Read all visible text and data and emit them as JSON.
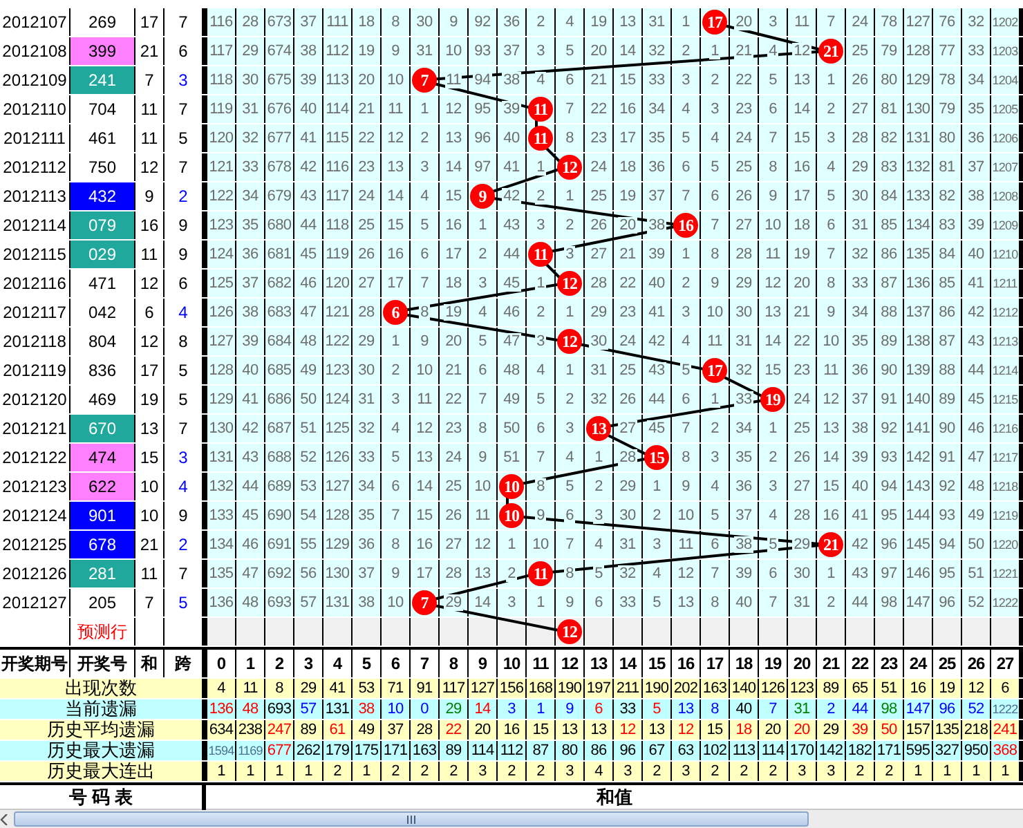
{
  "rows": [
    {
      "period": "2012107",
      "number": "269",
      "sum": "17",
      "span": "7",
      "cells": [
        "116",
        "28",
        "673",
        "37",
        "111",
        "18",
        "8",
        "30",
        "9",
        "92",
        "36",
        "2",
        "4",
        "19",
        "13",
        "31",
        "1",
        {
          "value": "17",
          "hit": true
        },
        "20",
        "3",
        "11",
        "7",
        "24",
        "78",
        "127",
        "76",
        "32",
        "1202"
      ]
    },
    {
      "period": "2012108",
      "number": {
        "value": "399",
        "color": "#ff80ff"
      },
      "sum": "21",
      "span": "6",
      "cells": [
        "117",
        "29",
        "674",
        "38",
        "112",
        "19",
        "9",
        "31",
        "10",
        "93",
        "37",
        "3",
        "5",
        "20",
        "14",
        "32",
        "2",
        "1",
        "21",
        "4",
        "12",
        {
          "value": "21",
          "hit": true
        },
        "25",
        "79",
        "128",
        "77",
        "33",
        "1203"
      ]
    },
    {
      "period": "2012109",
      "number": {
        "value": "241",
        "color": "#20a89c"
      },
      "sum": "7",
      "span": {
        "value": "3",
        "color": "#0000ff"
      },
      "cells": [
        "118",
        "30",
        "675",
        "39",
        "113",
        "20",
        "10",
        {
          "value": "7",
          "hit": true
        },
        "11",
        "94",
        "38",
        "4",
        "6",
        "21",
        "15",
        "33",
        "3",
        "2",
        "22",
        "5",
        "13",
        "1",
        "26",
        "80",
        "129",
        "78",
        "34",
        "1204"
      ]
    },
    {
      "period": "2012110",
      "number": "704",
      "sum": "11",
      "span": "7",
      "cells": [
        "119",
        "31",
        "676",
        "40",
        "114",
        "21",
        "11",
        "1",
        "12",
        "95",
        "39",
        {
          "value": "11",
          "hit": true
        },
        "7",
        "22",
        "16",
        "34",
        "4",
        "3",
        "23",
        "6",
        "14",
        "2",
        "27",
        "81",
        "130",
        "79",
        "35",
        "1205"
      ]
    },
    {
      "period": "2012111",
      "number": "461",
      "sum": "11",
      "span": "5",
      "cells": [
        "120",
        "32",
        "677",
        "41",
        "115",
        "22",
        "12",
        "2",
        "13",
        "96",
        "40",
        {
          "value": "11",
          "hit": true
        },
        "8",
        "23",
        "17",
        "35",
        "5",
        "4",
        "24",
        "7",
        "15",
        "3",
        "28",
        "82",
        "131",
        "80",
        "36",
        "1206"
      ]
    },
    {
      "period": "2012112",
      "number": "750",
      "sum": "12",
      "span": "7",
      "cells": [
        "121",
        "33",
        "678",
        "42",
        "116",
        "23",
        "13",
        "3",
        "14",
        "97",
        "41",
        "1",
        {
          "value": "12",
          "hit": true
        },
        "24",
        "18",
        "36",
        "6",
        "5",
        "25",
        "8",
        "16",
        "4",
        "29",
        "83",
        "132",
        "81",
        "37",
        "1207"
      ]
    },
    {
      "period": "2012113",
      "number": {
        "value": "432",
        "color": "#0000ff"
      },
      "sum": "9",
      "span": {
        "value": "2",
        "color": "#0000ff"
      },
      "cells": [
        "122",
        "34",
        "679",
        "43",
        "117",
        "24",
        "14",
        "4",
        "15",
        {
          "value": "9",
          "hit": true
        },
        "42",
        "2",
        "1",
        "25",
        "19",
        "37",
        "7",
        "6",
        "26",
        "9",
        "17",
        "5",
        "30",
        "84",
        "133",
        "82",
        "38",
        "1208"
      ]
    },
    {
      "period": "2012114",
      "number": {
        "value": "079",
        "color": "#20a89c"
      },
      "sum": "16",
      "span": "9",
      "cells": [
        "123",
        "35",
        "680",
        "44",
        "118",
        "25",
        "15",
        "5",
        "16",
        "1",
        "43",
        "3",
        "2",
        "26",
        "20",
        "38",
        {
          "value": "16",
          "hit": true
        },
        "7",
        "27",
        "10",
        "18",
        "6",
        "31",
        "85",
        "134",
        "83",
        "39",
        "1209"
      ]
    },
    {
      "period": "2012115",
      "number": {
        "value": "029",
        "color": "#20a89c"
      },
      "sum": "11",
      "span": "9",
      "cells": [
        "124",
        "36",
        "681",
        "45",
        "119",
        "26",
        "16",
        "6",
        "17",
        "2",
        "44",
        {
          "value": "11",
          "hit": true
        },
        "3",
        "27",
        "21",
        "39",
        "1",
        "8",
        "28",
        "11",
        "19",
        "7",
        "32",
        "86",
        "135",
        "84",
        "40",
        "1210"
      ]
    },
    {
      "period": "2012116",
      "number": "471",
      "sum": "12",
      "span": "6",
      "cells": [
        "125",
        "37",
        "682",
        "46",
        "120",
        "27",
        "17",
        "7",
        "18",
        "3",
        "45",
        "1",
        {
          "value": "12",
          "hit": true
        },
        "28",
        "22",
        "40",
        "2",
        "9",
        "29",
        "12",
        "20",
        "8",
        "33",
        "87",
        "136",
        "85",
        "41",
        "1211"
      ]
    },
    {
      "period": "2012117",
      "number": "042",
      "sum": "6",
      "span": {
        "value": "4",
        "color": "#0000ff"
      },
      "cells": [
        "126",
        "38",
        "683",
        "47",
        "121",
        "28",
        {
          "value": "6",
          "hit": true
        },
        "8",
        "19",
        "4",
        "46",
        "2",
        "1",
        "29",
        "23",
        "41",
        "3",
        "10",
        "30",
        "13",
        "21",
        "9",
        "34",
        "88",
        "137",
        "86",
        "42",
        "1212"
      ]
    },
    {
      "period": "2012118",
      "number": "804",
      "sum": "12",
      "span": "8",
      "cells": [
        "127",
        "39",
        "684",
        "48",
        "122",
        "29",
        "1",
        "9",
        "20",
        "5",
        "47",
        "3",
        {
          "value": "12",
          "hit": true
        },
        "30",
        "24",
        "42",
        "4",
        "11",
        "31",
        "14",
        "22",
        "10",
        "35",
        "89",
        "138",
        "87",
        "43",
        "1213"
      ]
    },
    {
      "period": "2012119",
      "number": "836",
      "sum": "17",
      "span": "5",
      "cells": [
        "128",
        "40",
        "685",
        "49",
        "123",
        "30",
        "2",
        "10",
        "21",
        "6",
        "48",
        "4",
        "1",
        "31",
        "25",
        "43",
        "5",
        {
          "value": "17",
          "hit": true
        },
        "32",
        "15",
        "23",
        "11",
        "36",
        "90",
        "139",
        "88",
        "44",
        "1214"
      ]
    },
    {
      "period": "2012120",
      "number": "469",
      "sum": "19",
      "span": "5",
      "cells": [
        "129",
        "41",
        "686",
        "50",
        "124",
        "31",
        "3",
        "11",
        "22",
        "7",
        "49",
        "5",
        "2",
        "32",
        "26",
        "44",
        "6",
        "1",
        "33",
        {
          "value": "19",
          "hit": true
        },
        "24",
        "12",
        "37",
        "91",
        "140",
        "89",
        "45",
        "1215"
      ]
    },
    {
      "period": "2012121",
      "number": {
        "value": "670",
        "color": "#20a89c"
      },
      "sum": "13",
      "span": "7",
      "cells": [
        "130",
        "42",
        "687",
        "51",
        "125",
        "32",
        "4",
        "12",
        "23",
        "8",
        "50",
        "6",
        "3",
        {
          "value": "13",
          "hit": true
        },
        "27",
        "45",
        "7",
        "2",
        "34",
        "1",
        "25",
        "13",
        "38",
        "92",
        "141",
        "90",
        "46",
        "1216"
      ]
    },
    {
      "period": "2012122",
      "number": {
        "value": "474",
        "color": "#ff80ff"
      },
      "sum": "15",
      "span": {
        "value": "3",
        "color": "#0000ff"
      },
      "cells": [
        "131",
        "43",
        "688",
        "52",
        "126",
        "33",
        "5",
        "13",
        "24",
        "9",
        "51",
        "7",
        "4",
        "1",
        "28",
        {
          "value": "15",
          "hit": true
        },
        "8",
        "3",
        "35",
        "2",
        "26",
        "14",
        "39",
        "93",
        "142",
        "91",
        "47",
        "1217"
      ]
    },
    {
      "period": "2012123",
      "number": {
        "value": "622",
        "color": "#ff80ff"
      },
      "sum": "10",
      "span": {
        "value": "4",
        "color": "#0000ff"
      },
      "cells": [
        "132",
        "44",
        "689",
        "53",
        "127",
        "34",
        "6",
        "14",
        "25",
        "10",
        {
          "value": "10",
          "hit": true
        },
        "8",
        "5",
        "2",
        "29",
        "1",
        "9",
        "4",
        "36",
        "3",
        "27",
        "15",
        "40",
        "94",
        "143",
        "92",
        "48",
        "1218"
      ]
    },
    {
      "period": "2012124",
      "number": {
        "value": "901",
        "color": "#0000ff"
      },
      "sum": "10",
      "span": "9",
      "cells": [
        "133",
        "45",
        "690",
        "54",
        "128",
        "35",
        "7",
        "15",
        "26",
        "11",
        {
          "value": "10",
          "hit": true
        },
        "9",
        "6",
        "3",
        "30",
        "2",
        "10",
        "5",
        "37",
        "4",
        "28",
        "16",
        "41",
        "95",
        "144",
        "93",
        "49",
        "1219"
      ]
    },
    {
      "period": "2012125",
      "number": {
        "value": "678",
        "color": "#0000ff"
      },
      "sum": "21",
      "span": {
        "value": "2",
        "color": "#0000ff"
      },
      "cells": [
        "134",
        "46",
        "691",
        "55",
        "129",
        "36",
        "8",
        "16",
        "27",
        "12",
        "1",
        "10",
        "7",
        "4",
        "31",
        "3",
        "11",
        "6",
        "38",
        "5",
        "29",
        {
          "value": "21",
          "hit": true
        },
        "42",
        "96",
        "145",
        "94",
        "50",
        "1220"
      ]
    },
    {
      "period": "2012126",
      "number": {
        "value": "281",
        "color": "#20a89c"
      },
      "sum": "11",
      "span": "7",
      "cells": [
        "135",
        "47",
        "692",
        "56",
        "130",
        "37",
        "9",
        "17",
        "28",
        "13",
        "2",
        {
          "value": "11",
          "hit": true
        },
        "8",
        "5",
        "32",
        "4",
        "12",
        "7",
        "39",
        "6",
        "30",
        "1",
        "43",
        "97",
        "146",
        "95",
        "51",
        "1221"
      ]
    },
    {
      "period": "2012127",
      "number": "205",
      "sum": "7",
      "span": {
        "value": "5",
        "color": "#0000ff"
      },
      "cells": [
        "136",
        "48",
        "693",
        "57",
        "131",
        "38",
        "10",
        {
          "value": "7",
          "hit": true
        },
        "29",
        "14",
        "3",
        "1",
        "9",
        "6",
        "33",
        "5",
        "13",
        "8",
        "40",
        "7",
        "31",
        "2",
        "44",
        "98",
        "147",
        "96",
        "52",
        "1222"
      ]
    }
  ],
  "prediction": {
    "label": "预测行",
    "cells": [
      null,
      null,
      null,
      null,
      null,
      null,
      null,
      null,
      null,
      null,
      null,
      null,
      {
        "value": "12",
        "hit": true
      },
      null,
      null,
      null,
      null,
      null,
      null,
      null,
      null,
      null,
      null,
      null,
      null,
      null,
      null,
      null
    ]
  },
  "header": {
    "columns": [
      "开奖期号",
      "开奖号",
      "和",
      "跨"
    ],
    "values": [
      "0",
      "1",
      "2",
      "3",
      "4",
      "5",
      "6",
      "7",
      "8",
      "9",
      "10",
      "11",
      "12",
      "13",
      "14",
      "15",
      "16",
      "17",
      "18",
      "19",
      "20",
      "21",
      "22",
      "23",
      "24",
      "25",
      "26",
      "27"
    ]
  },
  "stats": [
    {
      "label": "出现次数",
      "values": [
        "4",
        "11",
        "8",
        "29",
        "41",
        "53",
        "71",
        "91",
        "117",
        "127",
        "156",
        "168",
        "190",
        "197",
        "211",
        "190",
        "202",
        "163",
        "140",
        "126",
        "123",
        "89",
        "65",
        "51",
        "16",
        "19",
        "12",
        "6"
      ]
    },
    {
      "label": "当前遗漏",
      "values": [
        {
          "value": "136",
          "color": "#ff0000"
        },
        {
          "value": "48",
          "color": "#ff0000"
        },
        "693",
        {
          "value": "57",
          "color": "#0000ff"
        },
        "131",
        {
          "value": "38",
          "color": "#ff0000"
        },
        {
          "value": "10",
          "color": "#0000ff"
        },
        {
          "value": "0",
          "color": "#0000ff"
        },
        {
          "value": "29",
          "color": "#008000"
        },
        {
          "value": "14",
          "color": "#ff0000"
        },
        {
          "value": "3",
          "color": "#0000ff"
        },
        {
          "value": "1",
          "color": "#0000ff"
        },
        {
          "value": "9",
          "color": "#0000ff"
        },
        {
          "value": "6",
          "color": "#ff0000"
        },
        "33",
        {
          "value": "5",
          "color": "#ff0000"
        },
        {
          "value": "13",
          "color": "#0000ff"
        },
        {
          "value": "8",
          "color": "#0000ff"
        },
        "40",
        {
          "value": "7",
          "color": "#0000ff"
        },
        {
          "value": "31",
          "color": "#008000"
        },
        {
          "value": "2",
          "color": "#0000ff"
        },
        {
          "value": "44",
          "color": "#0000ff"
        },
        {
          "value": "98",
          "color": "#008000"
        },
        {
          "value": "147",
          "color": "#0000ff"
        },
        {
          "value": "96",
          "color": "#0000ff"
        },
        {
          "value": "52",
          "color": "#0000ff"
        },
        {
          "value": "1222",
          "color": "#4f6f8f"
        }
      ]
    },
    {
      "label": "历史平均遗漏",
      "values": [
        "634",
        "238",
        {
          "value": "247",
          "color": "#ff0000"
        },
        "89",
        {
          "value": "61",
          "color": "#ff0000"
        },
        "49",
        "37",
        "28",
        {
          "value": "22",
          "color": "#ff0000"
        },
        "20",
        "16",
        "15",
        "13",
        "13",
        {
          "value": "12",
          "color": "#ff0000"
        },
        "13",
        {
          "value": "12",
          "color": "#ff0000"
        },
        "15",
        {
          "value": "18",
          "color": "#ff0000"
        },
        "20",
        {
          "value": "20",
          "color": "#ff0000"
        },
        "29",
        {
          "value": "39",
          "color": "#ff0000"
        },
        {
          "value": "50",
          "color": "#ff0000"
        },
        "157",
        "135",
        "218",
        {
          "value": "241",
          "color": "#ff0000"
        }
      ]
    },
    {
      "label": "历史最大遗漏",
      "values": [
        {
          "value": "1594",
          "color": "#4f6f8f"
        },
        {
          "value": "1169",
          "color": "#4f6f8f"
        },
        {
          "value": "677",
          "color": "#ff0000"
        },
        "262",
        "179",
        "175",
        "171",
        "163",
        "89",
        "114",
        "112",
        "87",
        "80",
        "86",
        "96",
        "67",
        "63",
        "102",
        "113",
        "114",
        "170",
        "142",
        "182",
        "171",
        "595",
        "327",
        "950",
        {
          "value": "368",
          "color": "#ff0000"
        }
      ]
    },
    {
      "label": "历史最大连出",
      "values": [
        "1",
        "1",
        "1",
        "1",
        "2",
        "1",
        "2",
        "2",
        "2",
        "3",
        "2",
        "2",
        "3",
        "4",
        "3",
        "2",
        "3",
        "2",
        "2",
        "2",
        "3",
        "3",
        "2",
        "2",
        "1",
        "1",
        "1",
        "1"
      ]
    }
  ],
  "footer": {
    "left": "号 码 表",
    "right": "和值"
  }
}
